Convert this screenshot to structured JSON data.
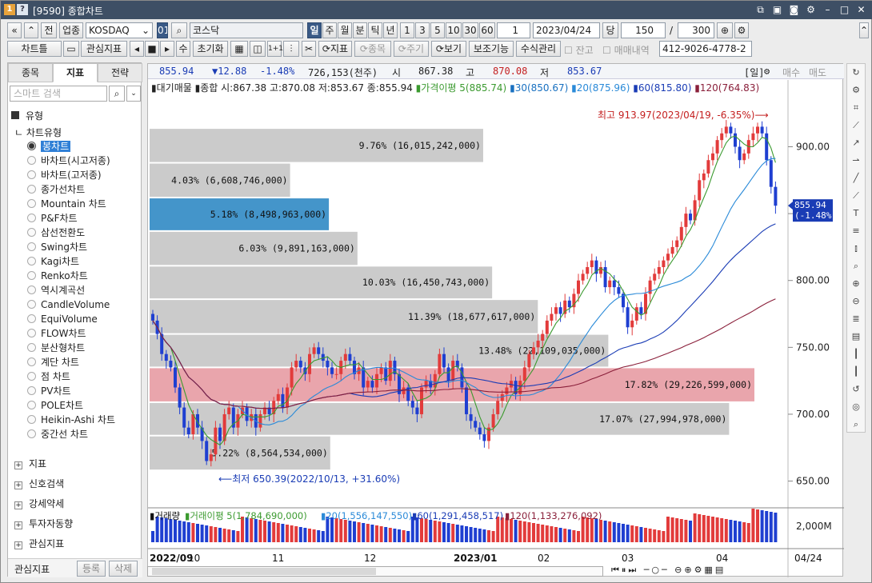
{
  "window": {
    "title": "[9590] 종합차트",
    "icons": [
      "minimize-to-tray-icon",
      "layout-icon",
      "screenshot-icon",
      "settings-icon",
      "minimize-icon",
      "maximize-icon",
      "close-icon"
    ]
  },
  "toolbar1": {
    "nav_prev": "«",
    "nav_up": "»",
    "prev_label": "전",
    "sector_label": "업종",
    "market_code": "KOSDAQ",
    "sector_code": "01",
    "sector_name": "코스닥",
    "periods": [
      "일",
      "주",
      "월",
      "분",
      "틱",
      "년"
    ],
    "period_selected": "일",
    "intervals": [
      "1",
      "3",
      "5",
      "10",
      "30",
      "60"
    ],
    "count_value": "1",
    "date": "2023/04/24",
    "date_suffix": "당",
    "bar_count": "150",
    "bar_max": "300"
  },
  "toolbar2": {
    "chart_type": "차트틀",
    "watch_label": "관심지표",
    "step_label": "수",
    "init_label": "초기화",
    "indicator_label": "지표",
    "stock_label": "종목",
    "cycle_label": "주기",
    "view_label": "보기",
    "aux_label": "보조기능",
    "formula_label": "수식관리",
    "balance_label": "잔고",
    "trade_label": "매매내역",
    "account": "412-9026-4778-2"
  },
  "left_panel": {
    "tabs": [
      "종목",
      "지표",
      "전략"
    ],
    "active_tab": "지표",
    "search_placeholder": "스마트 검색",
    "group_label": "유형",
    "sub_label": "차트유형",
    "items": [
      "봉차트",
      "바차트(시고저종)",
      "바차트(고저종)",
      "종가선차트",
      "Mountain 차트",
      "P&F차트",
      "삼선전환도",
      "Swing차트",
      "Kagi차트",
      "Renko차트",
      "역시계곡선",
      "CandleVolume",
      "EquiVolume",
      "FLOW차트",
      "분산형차트",
      "계단 차트",
      "점 차트",
      "PV차트",
      "POLE차트",
      "Heikin-Ashi 차트",
      "중간선 차트"
    ],
    "selected": "봉차트",
    "trees": [
      "지표",
      "신호검색",
      "강세약세",
      "투자자동향",
      "관심지표"
    ],
    "bottom_label": "관심지표",
    "register_label": "등록",
    "delete_label": "삭제"
  },
  "quote": {
    "price": "855.94",
    "change": "▼12.88",
    "pct": "-1.48%",
    "volume": "726,153(천주)",
    "open_label": "시",
    "open": "867.38",
    "high_label": "고",
    "high": "870.08",
    "low_label": "저",
    "low": "853.67",
    "period_tag": "[일]",
    "buy": "매수",
    "sell": "매도"
  },
  "legend": {
    "name": "대기매물",
    "summary": "종합 시:867.38 고:870.08 저:853.67 종:855.94",
    "ma5": "가격이평 5(885.74)",
    "ma20": "30(850.67)",
    "ma60": "20(875.96)",
    "ma_a": "60(815.80)",
    "ma_b": "120(764.83)"
  },
  "annotations": {
    "high": "최고 913.97(2023/04/19, -6.35%)⟶",
    "low": "⟵최저 650.39(2022/10/13, +31.60%)",
    "last_price": "855.94",
    "last_pct": "(-1.48%)"
  },
  "volume_legend": {
    "name": "거래량",
    "ma5": "거래이평 5(1,784,690,000)",
    "ma20": "20(1,556,147,550)",
    "ma60": "60(1,291,458,517)",
    "ma120": "120(1,133,276,092)",
    "unit": "2,000M"
  },
  "x_axis": {
    "labels": [
      "2022/09",
      "10",
      "11",
      "12",
      "2023/01",
      "02",
      "03",
      "04"
    ],
    "right_label": "04/24"
  },
  "colors": {
    "up": "#e23b3b",
    "down": "#1f3fd1",
    "profile": "#c8c8c8",
    "profile_sel": "#3a8fc7",
    "profile_max": "#e8a0a8",
    "ma5": "#3b9a2f",
    "ma20": "#1870c0",
    "ma60": "#1a3cb5",
    "ma120": "#8a1f3a"
  },
  "chart_data": {
    "type": "candlestick",
    "y_ticks": [
      650,
      700,
      750,
      800,
      850,
      900
    ],
    "y_tick_labels": [
      "650.00",
      "700.00",
      "750.00",
      "800.00",
      "",
      "900.00"
    ],
    "ylim": [
      630,
      932
    ],
    "volume_profile": [
      {
        "price_lo": 888,
        "price_hi": 914,
        "pct": "9.76%",
        "volume": "(16,015,242,000)",
        "value": 16015242000
      },
      {
        "price_lo": 862,
        "price_hi": 888,
        "pct": "4.03%",
        "volume": "(6,608,746,000)",
        "value": 6608746000
      },
      {
        "price_lo": 837,
        "price_hi": 862,
        "pct": "5.18%",
        "volume": "(8,498,963,000)",
        "value": 8498963000
      },
      {
        "price_lo": 811,
        "price_hi": 837,
        "pct": "6.03%",
        "volume": "(9,891,163,000)",
        "value": 9891163000
      },
      {
        "price_lo": 786,
        "price_hi": 811,
        "pct": "10.03%",
        "volume": "(16,450,743,000)",
        "value": 16450743000
      },
      {
        "price_lo": 760,
        "price_hi": 786,
        "pct": "11.39%",
        "volume": "(18,677,617,000)",
        "value": 18677617000
      },
      {
        "price_lo": 735,
        "price_hi": 760,
        "pct": "13.48%",
        "volume": "(22,109,035,000)",
        "value": 22109035000
      },
      {
        "price_lo": 709,
        "price_hi": 735,
        "pct": "17.82%",
        "volume": "(29,226,599,000)",
        "value": 29226599000
      },
      {
        "price_lo": 684,
        "price_hi": 709,
        "pct": "17.07%",
        "volume": "(27,994,978,000)",
        "value": 27994978000
      },
      {
        "price_lo": 658,
        "price_hi": 684,
        "pct": "5.22%",
        "volume": "(8,564,534,000)",
        "value": 8564534000
      }
    ],
    "close_series": [
      770,
      760,
      745,
      740,
      735,
      720,
      705,
      690,
      685,
      700,
      690,
      680,
      665,
      670,
      690,
      680,
      700,
      705,
      690,
      700,
      705,
      695,
      700,
      690,
      700,
      705,
      700,
      710,
      715,
      705,
      720,
      735,
      740,
      735,
      730,
      745,
      750,
      745,
      740,
      735,
      730,
      730,
      740,
      745,
      740,
      730,
      735,
      720,
      725,
      720,
      730,
      735,
      725,
      740,
      730,
      715,
      720,
      710,
      705,
      700,
      720,
      725,
      720,
      730,
      745,
      735,
      725,
      740,
      735,
      720,
      700,
      695,
      690,
      685,
      680,
      690,
      700,
      710,
      715,
      720,
      725,
      715,
      725,
      735,
      745,
      750,
      755,
      760,
      770,
      775,
      780,
      775,
      785,
      780,
      790,
      800,
      805,
      810,
      815,
      805,
      810,
      795,
      800,
      795,
      790,
      780,
      765,
      770,
      780,
      775,
      790,
      800,
      805,
      810,
      815,
      820,
      825,
      830,
      840,
      850,
      845,
      860,
      875,
      880,
      890,
      895,
      905,
      910,
      915,
      910,
      900,
      890,
      895,
      905,
      910,
      915,
      910,
      890,
      870,
      855.94
    ],
    "ma_lines": {
      "ma5": "fast",
      "ma20": "mid",
      "ma60": "slow",
      "ma120": "slowest"
    }
  }
}
